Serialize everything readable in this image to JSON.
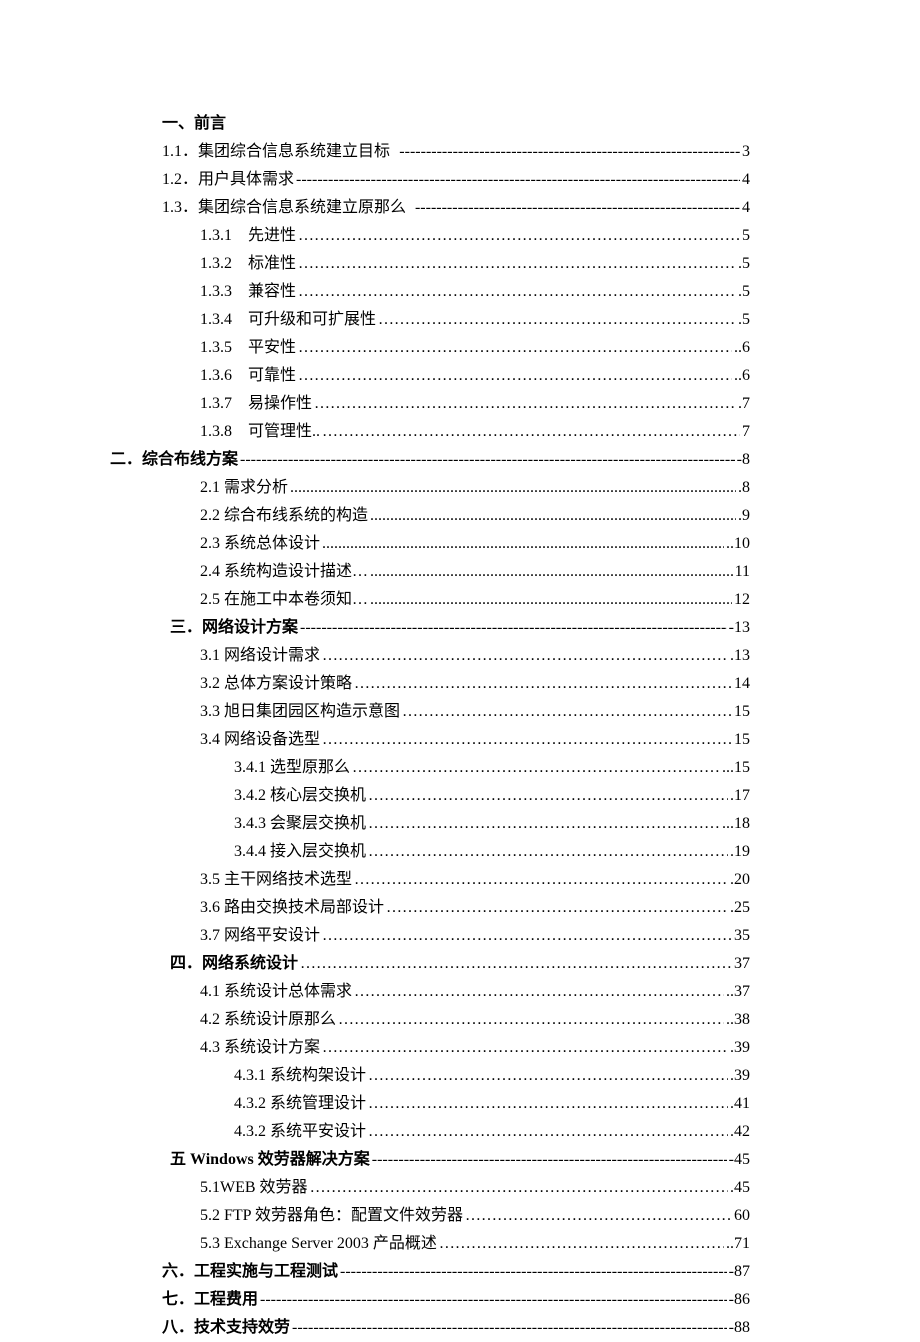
{
  "toc": [
    {
      "label": "一、前言",
      "bold": true,
      "indent": "ind1",
      "leader": "none",
      "page": ""
    },
    {
      "label": "1.1．集团综合信息系统建立目标",
      "indent": "ind1",
      "leader": "dashes",
      "gap": true,
      "page": "3"
    },
    {
      "label": "1.2．用户具体需求",
      "indent": "ind1",
      "leader": "dashes",
      "page": "4"
    },
    {
      "label": "1.3．集团综合信息系统建立原那么",
      "indent": "ind1",
      "leader": "dashes",
      "gap": true,
      "page": "4"
    },
    {
      "label": "1.3.1　先进性",
      "indent": "ind2",
      "leader": "dots",
      "page": "5"
    },
    {
      "label": "1.3.2　标准性",
      "indent": "ind2",
      "leader": "dots",
      "page": ".5"
    },
    {
      "label": "1.3.3　兼容性",
      "indent": "ind2",
      "leader": "dots",
      "page": ".5"
    },
    {
      "label": "1.3.4　可升级和可扩展性",
      "indent": "ind2",
      "leader": "dots",
      "page": ".5"
    },
    {
      "label": "1.3.5　平安性",
      "indent": "ind2",
      "leader": "dots",
      "page": "..6"
    },
    {
      "label": "1.3.6　可靠性",
      "indent": "ind2",
      "leader": "dots",
      "page": "..6"
    },
    {
      "label": "1.3.7　易操作性",
      "indent": "ind2",
      "leader": "dots",
      "page": ".7"
    },
    {
      "label": "1.3.8　可管理性..",
      "indent": "ind2",
      "leader": "dots",
      "page": "7"
    },
    {
      "label": "二．综合布线方案",
      "bold": true,
      "indent": "neg",
      "leader": "dashes",
      "page": "-8"
    },
    {
      "label": "2.1 需求分析",
      "indent": "ind2",
      "leader": "dotsPeriod",
      "page": ".8"
    },
    {
      "label": "2.2 综合布线系统的构造",
      "indent": "ind2",
      "leader": "dotsPeriod",
      "page": ".9"
    },
    {
      "label": "2.3 系统总体设计",
      "indent": "ind2",
      "leader": "dotsPeriod",
      "page": "..10"
    },
    {
      "label": "2.4 系统构造设计描述…",
      "indent": "ind2",
      "leader": "dotsPeriod",
      "page": "11"
    },
    {
      "label": "2.5 在施工中本卷须知…",
      "indent": "ind2",
      "leader": "dotsPeriod",
      "page": "12"
    },
    {
      "label": "三．网络设计方案",
      "bold": true,
      "indent": "ind-a",
      "leader": "dashes",
      "page": "-13"
    },
    {
      "label": "3.1 网络设计需求",
      "indent": "ind2",
      "leader": "dots",
      "page": ".13"
    },
    {
      "label": "3.2 总体方案设计策略",
      "indent": "ind2",
      "leader": "dots",
      "page": "14"
    },
    {
      "label": "3.3 旭日集团园区构造示意图",
      "indent": "ind2",
      "leader": "dots",
      "page": "15"
    },
    {
      "label": "3.4 网络设备选型",
      "indent": "ind2",
      "leader": "dots",
      "page": "15"
    },
    {
      "label": "3.4.1 选型原那么",
      "indent": "ind3",
      "leader": "dots",
      "page": "...15"
    },
    {
      "label": "3.4.2 核心层交换机",
      "indent": "ind3",
      "leader": "dots",
      "page": ".17"
    },
    {
      "label": "3.4.3 会聚层交换机",
      "indent": "ind3",
      "leader": "dots",
      "page": "...18"
    },
    {
      "label": "3.4.4 接入层交换机",
      "indent": "ind3",
      "leader": "dots",
      "page": ".19"
    },
    {
      "label": "3.5 主干网络技术选型",
      "indent": "ind2",
      "leader": "dots",
      "page": ".20"
    },
    {
      "label": "3.6 路由交换技术局部设计",
      "indent": "ind2",
      "leader": "dots",
      "page": ".25"
    },
    {
      "label": "3.7 网络平安设计",
      "indent": "ind2",
      "leader": "dots",
      "page": "35"
    },
    {
      "label": "四．网络系统设计",
      "bold": true,
      "indent": "ind-a",
      "leader": "dots",
      "page": "37"
    },
    {
      "label": "4.1  系统设计总体需求",
      "indent": "ind2",
      "leader": "dots",
      "page": "..37"
    },
    {
      "label": "4.2  系统设计原那么",
      "indent": "ind2",
      "leader": "dots",
      "page": "..38"
    },
    {
      "label": "4.3  系统设计方案",
      "indent": "ind2",
      "leader": "dots",
      "page": ".39"
    },
    {
      "label": "4.3.1 系统构架设计",
      "indent": "ind3",
      "leader": "dots",
      "page": ".39"
    },
    {
      "label": "4.3.2  系统管理设计",
      "indent": "ind3",
      "leader": "dots",
      "page": ".41"
    },
    {
      "label": "4.3.2  系统平安设计",
      "indent": "ind3",
      "leader": "dots",
      "page": ".42"
    },
    {
      "label": "五  Windows 效劳器解决方案",
      "bold": true,
      "indent": "ind-a",
      "leader": "dashes",
      "page": "-45"
    },
    {
      "label": "5.1WEB 效劳器",
      "indent": "ind2",
      "leader": "dots",
      "page": ".45"
    },
    {
      "label": "5.2 FTP 效劳器角色：配置文件效劳器",
      "indent": "ind2",
      "leader": "dots",
      "page": "60"
    },
    {
      "label": "5.3 Exchange Server 2003  产品概述",
      "indent": "ind2",
      "leader": "dots",
      "page": "..71"
    },
    {
      "label": "六．工程实施与工程测试",
      "bold": true,
      "indent": "ind1",
      "leader": "dashes",
      "page": "-87"
    },
    {
      "label": "七．工程费用",
      "bold": true,
      "indent": "ind1",
      "leader": "dashes",
      "page": "-86"
    },
    {
      "label": "八．技术支持效劳",
      "bold": true,
      "indent": "ind1",
      "leader": "dashes",
      "page": "-88"
    }
  ]
}
